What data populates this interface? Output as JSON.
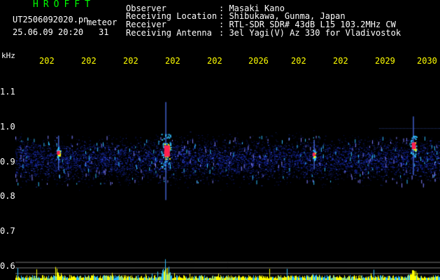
{
  "header": {
    "app_title": "HROFFT",
    "filename": "UT2506092020.pn",
    "meteor_label": "meteor",
    "datetime": "25.06.09 20:20",
    "sub_number": "31"
  },
  "station_info": [
    {
      "label": "Observer",
      "value": ": Masaki Kano"
    },
    {
      "label": "Receiving Location",
      "value": ": Shibukawa, Gunma, Japan"
    },
    {
      "label": "Receiver",
      "value": ": RTL-SDR SDR# 43dB L15 103.2MHz CW"
    },
    {
      "label": "Receiving Antenna",
      "value": ": 3el Yagi(V) Az 330 for Vladivostok"
    }
  ],
  "axis": {
    "y_unit": "kHz",
    "y_ticks": [
      "1.1",
      "1.0",
      "0.9",
      "0.8",
      "0.7",
      "0.6"
    ],
    "x_ticks": [
      "202",
      "202",
      "202",
      "202",
      "202",
      "2026",
      "202",
      "202",
      "2029",
      "2030"
    ]
  },
  "colors": {
    "background": "#000000",
    "noise_band": "#1a2a9a",
    "text_title": "#00ff00",
    "text_time": "#ffff00",
    "signal_hot": "#ff2050",
    "signal_warm": "#ffff00",
    "signal_cool": "#30c0ff",
    "amplitude_bars": "#ffff00"
  },
  "waterfall": {
    "noise_center_khz": 0.905,
    "noise_halfwidth_khz": 0.09,
    "carrier_khz": 0.996,
    "amplitude_baseline_khz": 0.59,
    "meteor_events": [
      {
        "minute": 20.333,
        "center_khz": 0.93,
        "intensity": 1.0
      },
      {
        "minute": 20.917,
        "center_khz": 0.945,
        "intensity": 0.6
      },
      {
        "minute": 20.08,
        "center_khz": 0.925,
        "intensity": 0.35
      },
      {
        "minute": 20.683,
        "center_khz": 0.92,
        "intensity": 0.3
      }
    ]
  }
}
